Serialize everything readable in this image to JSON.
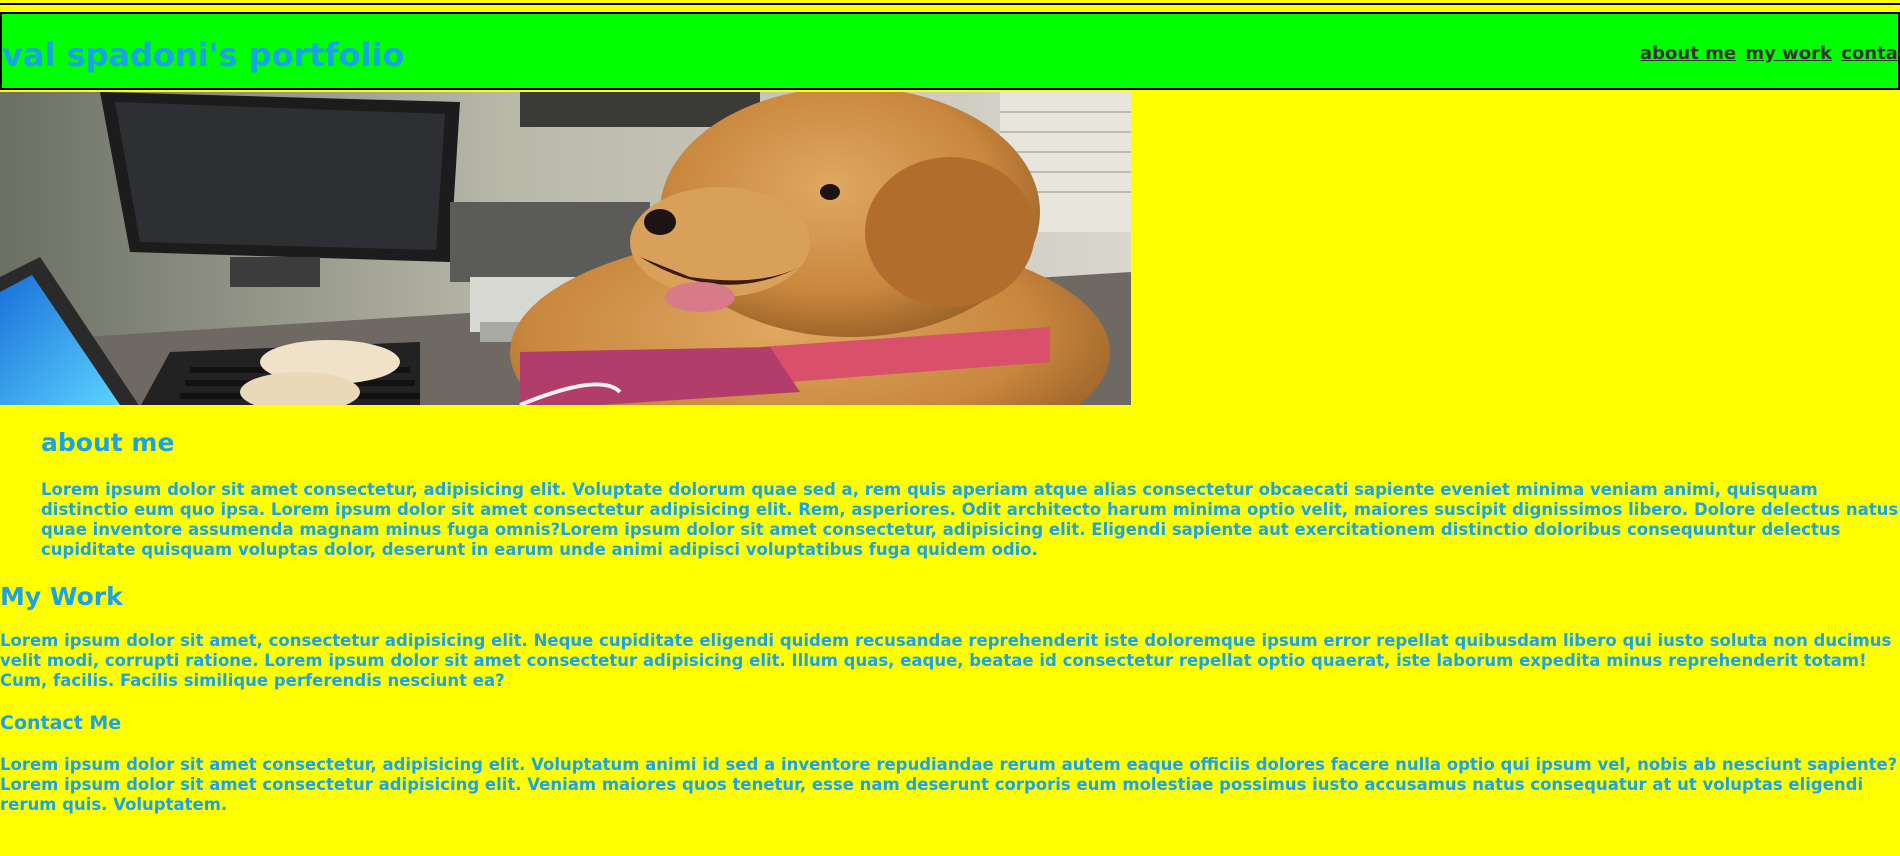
{
  "header": {
    "title": "val spadoni's portfolio",
    "nav": [
      "about me",
      "my work",
      "contact r"
    ]
  },
  "hero": {
    "image": "dog-at-computer-photo",
    "alt": "dog wearing a tie typing on a laptop"
  },
  "about": {
    "heading": "about me",
    "lines": [
      "Lorem ipsum dolor sit amet consectetur, adipisicing elit. Voluptate dolorum quae sed a, rem quis aperiam atque alias consectetur obcaecati sapiente eveniet minima veniam animi, quisquam",
      "distinctio eum quo ipsa. Lorem ipsum dolor sit amet consectetur adipisicing elit. Rem, asperiores. Odit architecto harum minima optio velit, maiores suscipit dignissimos libero. Dolore delectus natus",
      "quae inventore assumenda magnam minus fuga omnis?Lorem ipsum dolor sit amet consectetur, adipisicing elit. Eligendi sapiente aut exercitationem distinctio doloribus consequuntur delectus",
      "cupiditate quisquam voluptas dolor, deserunt in earum unde animi adipisci voluptatibus fuga quidem odio."
    ]
  },
  "work": {
    "heading": "My Work",
    "lines": [
      "Lorem ipsum dolor sit amet, consectetur adipisicing elit. Neque cupiditate eligendi quidem recusandae reprehenderit iste doloremque ipsum error repellat quibusdam libero qui iusto soluta non ducimus",
      "velit modi, corrupti ratione. Lorem ipsum dolor sit amet consectetur adipisicing elit. Illum quas, eaque, beatae id consectetur repellat optio quaerat, iste laborum expedita minus reprehenderit totam!",
      "Cum, facilis. Facilis similique perferendis nesciunt ea?"
    ]
  },
  "contact": {
    "heading": "Contact Me",
    "lines": [
      "Lorem ipsum dolor sit amet consectetur, adipisicing elit. Voluptatum animi id sed a inventore repudiandae rerum autem eaque officiis dolores facere nulla optio qui ipsum vel, nobis ab nesciunt sapiente?",
      "Lorem ipsum dolor sit amet consectetur adipisicing elit. Veniam maiores quos tenetur, esse nam deserunt corporis eum molestiae possimus iusto accusamus natus consequatur at ut voluptas eligendi",
      "rerum quis. Voluptatem."
    ]
  }
}
